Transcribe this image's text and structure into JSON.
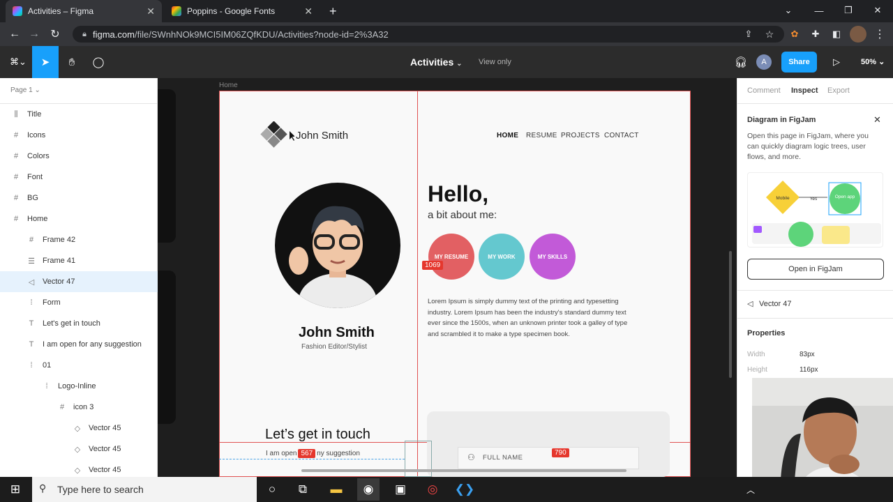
{
  "browser": {
    "tabs": [
      {
        "label": "Activities – Figma",
        "active": true
      },
      {
        "label": "Poppins - Google Fonts",
        "active": false
      }
    ],
    "new_tab_label": "+",
    "url_host": "figma.com",
    "url_path": "/file/SWnhNOk9MCI5IM06ZQfKDU/Activities?node-id=2%3A32"
  },
  "figma_toolbar": {
    "file_title": "Activities",
    "view_mode": "View only",
    "user_initial": "A",
    "share_label": "Share",
    "zoom": "50%"
  },
  "layers_panel": {
    "page": "Page 1",
    "items": [
      {
        "label": "Title",
        "icon": "frame-bars-icon",
        "glyph": "⫼",
        "indent": 0,
        "selected": false
      },
      {
        "label": "Icons",
        "icon": "frame-icon",
        "glyph": "#",
        "indent": 0,
        "selected": false
      },
      {
        "label": "Colors",
        "icon": "frame-icon",
        "glyph": "#",
        "indent": 0,
        "selected": false
      },
      {
        "label": "Font",
        "icon": "frame-icon",
        "glyph": "#",
        "indent": 0,
        "selected": false
      },
      {
        "label": "BG",
        "icon": "frame-icon",
        "glyph": "#",
        "indent": 0,
        "selected": false
      },
      {
        "label": "Home",
        "icon": "frame-icon",
        "glyph": "#",
        "indent": 0,
        "selected": false
      },
      {
        "label": "Frame 42",
        "icon": "frame-icon",
        "glyph": "#",
        "indent": 1,
        "selected": false
      },
      {
        "label": "Frame 41",
        "icon": "autolayout-icon",
        "glyph": "☰",
        "indent": 1,
        "selected": false
      },
      {
        "label": "Vector 47",
        "icon": "vector-icon",
        "glyph": "◁",
        "indent": 1,
        "selected": true
      },
      {
        "label": "Form",
        "icon": "group-icon",
        "glyph": "⁞",
        "indent": 1,
        "selected": false
      },
      {
        "label": "Let's get in touch",
        "icon": "text-icon",
        "glyph": "T",
        "indent": 1,
        "selected": false
      },
      {
        "label": "I am open for any suggestion",
        "icon": "text-icon",
        "glyph": "T",
        "indent": 1,
        "selected": false
      },
      {
        "label": "01",
        "icon": "group-icon",
        "glyph": "⁞",
        "indent": 1,
        "selected": false
      },
      {
        "label": "Logo-Inline",
        "icon": "group-icon",
        "glyph": "⁞",
        "indent": 2,
        "selected": false
      },
      {
        "label": "icon 3",
        "icon": "frame-icon",
        "glyph": "#",
        "indent": 3,
        "selected": false
      },
      {
        "label": "Vector 45",
        "icon": "vector-diamond-icon",
        "glyph": "◇",
        "indent": 4,
        "selected": false
      },
      {
        "label": "Vector 45",
        "icon": "vector-diamond-icon",
        "glyph": "◇",
        "indent": 4,
        "selected": false
      },
      {
        "label": "Vector 45",
        "icon": "vector-diamond-icon",
        "glyph": "◇",
        "indent": 4,
        "selected": false
      }
    ]
  },
  "canvas": {
    "frame_label": "Home",
    "brand": "John Smith",
    "nav": [
      "HOME",
      "RESUME",
      "PROJECTS",
      "CONTACT"
    ],
    "profile_name": "John Smith",
    "profile_role": "Fashion Editor/Stylist",
    "hello": "Hello,",
    "about": "a bit about me:",
    "circles": [
      {
        "label": "MY RESUME",
        "color": "#e26063"
      },
      {
        "label": "MY WORK",
        "color": "#64c8cf"
      },
      {
        "label": "MY SKILLS",
        "color": "#c25ad8"
      }
    ],
    "lorem": "Lorem Ipsum is simply dummy text of the printing and typesetting industry. Lorem Ipsum has been the industry's standard dummy text ever since the 1500s, when an unknown printer took a galley of type and scrambled it to make a type specimen book.",
    "touch_heading": "Let’s get in touch",
    "suggest_before": "I am open",
    "suggest_after": "ny suggestion",
    "fullname_placeholder": "FULL NAME",
    "measurements": {
      "m1": "1069",
      "m2": "567",
      "m3": "790"
    }
  },
  "right_panel": {
    "tabs": [
      "Comment",
      "Inspect",
      "Export"
    ],
    "active_tab": "Inspect",
    "figjam_title": "Diagram in FigJam",
    "figjam_desc": "Open this page in FigJam, where you can quickly diagram logic trees, user flows, and more.",
    "figjam_diagram": {
      "node1": "Mobile",
      "edge": "Yes",
      "node2": "Open app"
    },
    "open_button": "Open in FigJam",
    "selected_layer": "Vector 47",
    "properties_title": "Properties",
    "width_label": "Width",
    "width_value": "83px",
    "height_label": "Height",
    "height_value": "116px"
  },
  "taskbar": {
    "search_placeholder": "Type here to search"
  },
  "colors": {
    "figma_blue": "#18a0fb",
    "selection_red": "#e05050",
    "selected_row": "#e6f2fd"
  }
}
